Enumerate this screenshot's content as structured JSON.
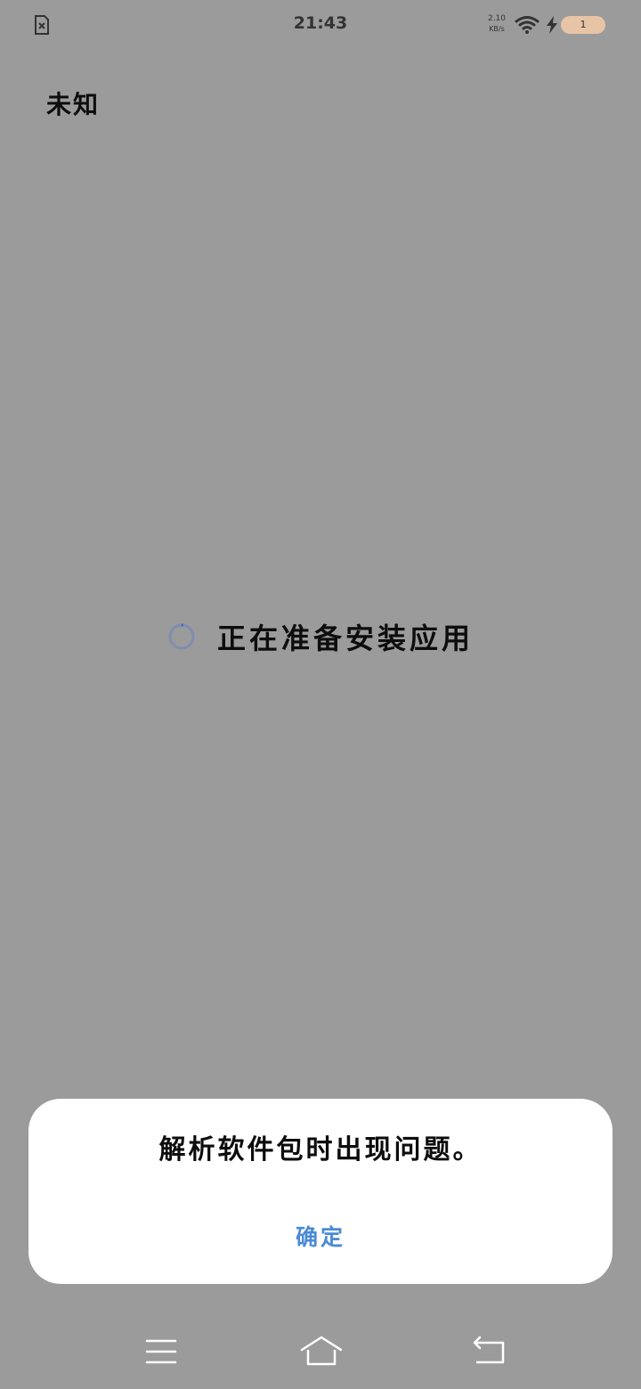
{
  "status_bar": {
    "time": "21:43",
    "net_speed_value": "2.10",
    "net_speed_unit": "KB/s",
    "battery_label": "1",
    "icons": [
      "file-error-icon",
      "wifi-icon",
      "charging-icon",
      "battery-icon"
    ]
  },
  "app": {
    "title": "未知"
  },
  "loading": {
    "text": "正在准备安装应用",
    "spinner_color": "#7f8db0"
  },
  "dialog": {
    "message": "解析软件包时出现问题。",
    "ok_label": "确定",
    "ok_color": "#4a8ad6"
  },
  "nav_bar": {
    "buttons": [
      "menu-icon",
      "home-icon",
      "back-icon"
    ]
  },
  "colors": {
    "scrim_background": "#9b9b9b",
    "dialog_background": "#ffffff",
    "battery_pill": "#e8c4a6"
  }
}
